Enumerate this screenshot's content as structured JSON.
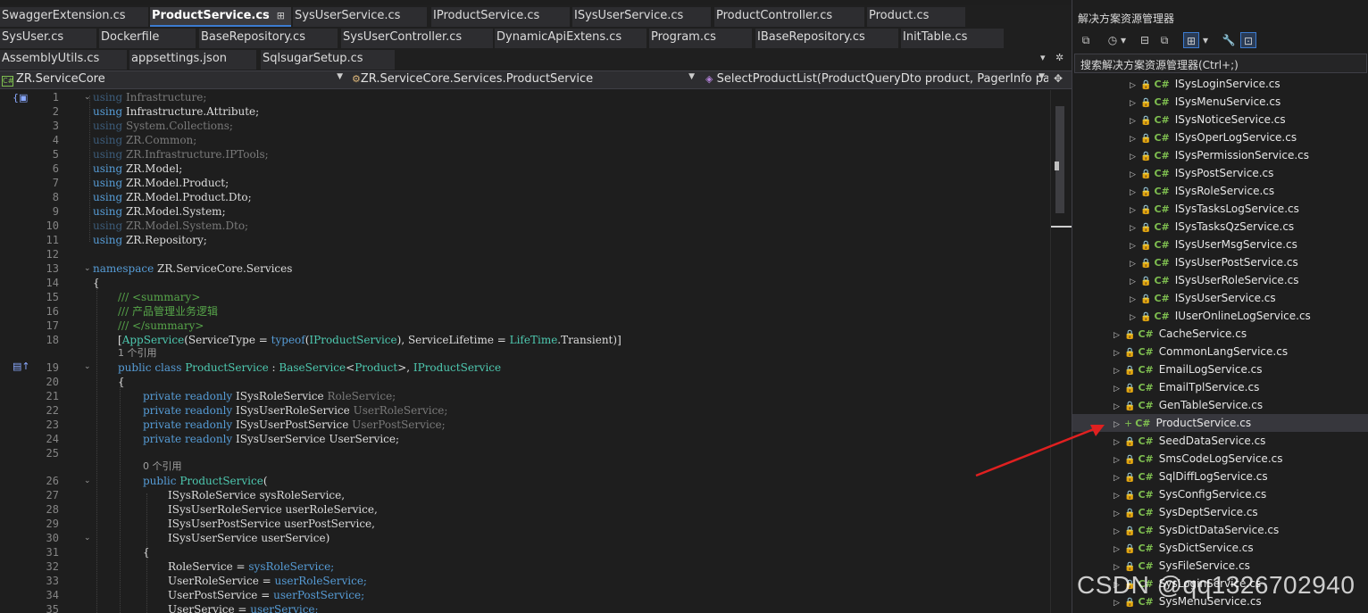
{
  "tabs_row1": [
    {
      "label": "SwaggerExtension.cs"
    },
    {
      "label": "ProductService.cs",
      "pin": "⊞",
      "close": "✕"
    },
    {
      "label": "SysUserService.cs"
    },
    {
      "label": "IProductService.cs"
    },
    {
      "label": "ISysUserService.cs"
    },
    {
      "label": "ProductController.cs"
    },
    {
      "label": "Product.cs"
    }
  ],
  "tabs_row2": [
    {
      "label": "SysUser.cs"
    },
    {
      "label": "Dockerfile"
    },
    {
      "label": "BaseRepository.cs"
    },
    {
      "label": "SysUserController.cs"
    },
    {
      "label": "DynamicApiExtens.cs"
    },
    {
      "label": "Program.cs"
    },
    {
      "label": "IBaseRepository.cs"
    },
    {
      "label": "InitTable.cs"
    }
  ],
  "tabs_row3": [
    {
      "label": "AssemblyUtils.cs"
    },
    {
      "label": "appsettings.json"
    },
    {
      "label": "SqlsugarSetup.cs"
    }
  ],
  "tab_controls": {
    "dropdown": "▾",
    "settings": "✲"
  },
  "navbar": {
    "project": "ZR.ServiceCore",
    "type": "ZR.ServiceCore.Services.ProductService",
    "member": "SelectProductList(ProductQueryDto product, PagerInfo pager",
    "split_icon": "✥"
  },
  "line_numbers": [
    "1",
    "2",
    "3",
    "4",
    "5",
    "6",
    "7",
    "8",
    "9",
    "10",
    "11",
    "12",
    "13",
    "14",
    "15",
    "16",
    "17",
    "18",
    "",
    "19",
    "20",
    "21",
    "22",
    "23",
    "24",
    "25",
    "",
    "26",
    "27",
    "28",
    "29",
    "30",
    "31",
    "32",
    "33",
    "34",
    "35"
  ],
  "code": {
    "l1": [
      "using",
      "Infrastructure;"
    ],
    "l2": [
      "using",
      "Infrastructure.Attribute;"
    ],
    "l3": [
      "using",
      "System.Collections;"
    ],
    "l4": [
      "using",
      "ZR.Common;"
    ],
    "l5": [
      "using",
      "ZR.Infrastructure.IPTools;"
    ],
    "l6": [
      "using",
      "ZR.Model;"
    ],
    "l7": [
      "using",
      "ZR.Model.Product;"
    ],
    "l8": [
      "using",
      "ZR.Model.Product.Dto;"
    ],
    "l9": [
      "using",
      "ZR.Model.System;"
    ],
    "l10": [
      "using",
      "ZR.Model.System.Dto;"
    ],
    "l11": [
      "using",
      "ZR.Repository;"
    ],
    "l13": [
      "namespace",
      "ZR.ServiceCore.Services"
    ],
    "l14": "{",
    "l15": "/// <summary>",
    "l16": "/// 产品管理业务逻辑",
    "l17": "/// </summary>",
    "l18": [
      "[",
      "AppService",
      "(ServiceType = ",
      "typeof",
      "(",
      "IProductService",
      "), ServiceLifetime = ",
      "LifeTime",
      ".Transient)]"
    ],
    "lens1": "1 个引用",
    "l19": [
      "public",
      "class",
      "ProductService",
      ":",
      "BaseService",
      "<",
      "Product",
      ">, ",
      "IProductService"
    ],
    "l20": "{",
    "l21": [
      "private",
      "readonly",
      "ISysRoleService",
      "RoleService;"
    ],
    "l22": [
      "private",
      "readonly",
      "ISysUserRoleService",
      "UserRoleService;"
    ],
    "l23": [
      "private",
      "readonly",
      "ISysUserPostService",
      "UserPostService;"
    ],
    "l24": [
      "private",
      "readonly",
      "ISysUserService",
      "UserService;"
    ],
    "lens2": "0 个引用",
    "l26": [
      "public",
      "ProductService",
      "("
    ],
    "l27": [
      "ISysRoleService",
      "sysRoleService,"
    ],
    "l28": [
      "ISysUserRoleService",
      "userRoleService,"
    ],
    "l29": [
      "ISysUserPostService",
      "userPostService,"
    ],
    "l30": [
      "ISysUserService",
      "userService)"
    ],
    "l31": "{",
    "l32": [
      "RoleService = ",
      "sysRoleService;"
    ],
    "l33": [
      "UserRoleService = ",
      "userRoleService;"
    ],
    "l34": [
      "UserPostService = ",
      "userPostService;"
    ],
    "l35": [
      "UserService = ",
      "userService;"
    ]
  },
  "solution": {
    "title": "解决方案资源管理器",
    "search_placeholder": "搜索解决方案资源管理器(Ctrl+;)",
    "toolbar": [
      "⧉",
      "◷",
      "▾",
      "⊟",
      "⧉",
      "⊞",
      "▾",
      "🔧",
      "⊡"
    ],
    "lock_glyph": "🔒",
    "cs_glyph": "C#",
    "inner_items": [
      "ISysLoginService.cs",
      "ISysMenuService.cs",
      "ISysNoticeService.cs",
      "ISysOperLogService.cs",
      "ISysPermissionService.cs",
      "ISysPostService.cs",
      "ISysRoleService.cs",
      "ISysTasksLogService.cs",
      "ISysTasksQzService.cs",
      "ISysUserMsgService.cs",
      "ISysUserPostService.cs",
      "ISysUserRoleService.cs",
      "ISysUserService.cs",
      "IUserOnlineLogService.cs"
    ],
    "outer_items": [
      "CacheService.cs",
      "CommonLangService.cs",
      "EmailLogService.cs",
      "EmailTplService.cs",
      "GenTableService.cs",
      "ProductService.cs",
      "SeedDataService.cs",
      "SmsCodeLogService.cs",
      "SqlDiffLogService.cs",
      "SysConfigService.cs",
      "SysDeptService.cs",
      "SysDictDataService.cs",
      "SysDictService.cs",
      "SysFileService.cs",
      "SysLoginService.cs",
      "SysMenuService.cs"
    ],
    "new_item": "ProductService.cs",
    "new_item_prefix": "+"
  },
  "watermark": "CSDN @qq1326702940",
  "colors": {
    "arrow": "#e02020",
    "keyword": "#569cd6",
    "type": "#4ec9b0",
    "comment": "#57a64a"
  }
}
